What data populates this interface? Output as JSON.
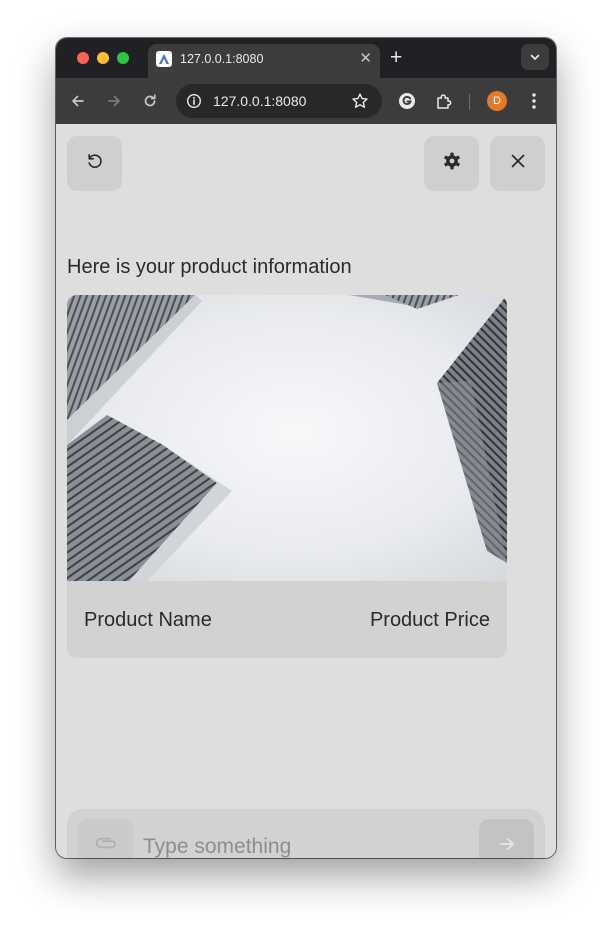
{
  "browser": {
    "tab": {
      "title": "127.0.0.1:8080",
      "favicon": "app-favicon-icon",
      "close_icon": "close-icon"
    },
    "new_tab_icon": "plus-icon",
    "tab_search_icon": "chevron-down-icon",
    "toolbar": {
      "back_icon": "arrow-left-icon",
      "forward_icon": "arrow-right-icon",
      "reload_icon": "reload-icon",
      "site_info_icon": "info-icon",
      "url": "127.0.0.1:8080",
      "bookmark_icon": "star-icon",
      "extension_icon": "grammarly-icon",
      "extensions_icon": "puzzle-icon",
      "profile_initial": "D",
      "profile_color": "#e07b2c",
      "menu_icon": "kebab-menu-icon"
    }
  },
  "chat": {
    "header": {
      "restart_icon": "restart-icon",
      "settings_icon": "gear-icon",
      "close_icon": "close-icon"
    },
    "message": "Here is your product information",
    "product_card": {
      "image": "skyscrapers-photo",
      "name": "Product Name",
      "price": "Product Price"
    },
    "composer": {
      "attach_icon": "paperclip-icon",
      "placeholder": "Type something",
      "value": "",
      "send_icon": "arrow-right-icon"
    }
  },
  "colors": {
    "page_background": "#dedede",
    "button_background": "#cfcfcf",
    "card_background": "#d2d2d2",
    "browser_chrome": "#3c3c3c"
  }
}
